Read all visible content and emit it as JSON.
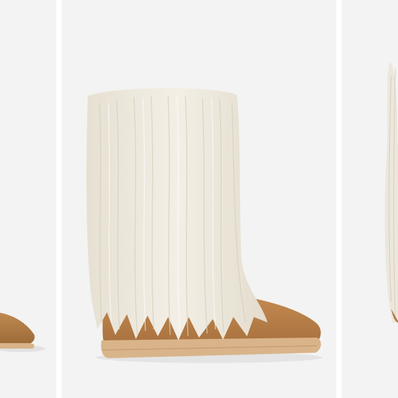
{
  "gallery": {
    "slides": [
      {
        "id": "prev",
        "alt": "product-image-previous"
      },
      {
        "id": "current",
        "alt": "product-image-current"
      },
      {
        "id": "next",
        "alt": "product-image-next"
      }
    ],
    "zoom_icon": "zoom-in-icon",
    "colors": {
      "background": "#f3f3f3",
      "suede": "#b8804a",
      "fur": "#ece7dc",
      "sole": "#d9b48a",
      "icon": "#9a9a9a"
    }
  }
}
